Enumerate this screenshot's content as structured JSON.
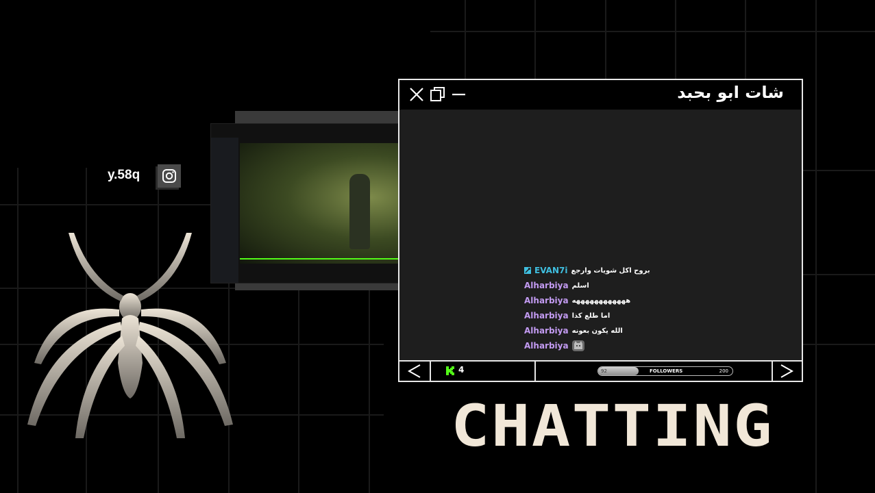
{
  "instagram": {
    "handle": "y.58q",
    "icon": "instagram-icon"
  },
  "chat": {
    "title": "شات ابو بحبد",
    "messages": [
      {
        "user": "EVAN7i",
        "user_color": "#3fbfe0",
        "badge": "sword-badge-icon",
        "text": "بروح اكل شويات وارجع"
      },
      {
        "user": "Alharbiya",
        "user_color": "#c39bf2",
        "text": "اسلم"
      },
      {
        "user": "Alharbiya",
        "user_color": "#c39bf2",
        "text": "ههههههههههههه"
      },
      {
        "user": "Alharbiya",
        "user_color": "#c39bf2",
        "text": "اما طلع كذا"
      },
      {
        "user": "Alharbiya",
        "user_color": "#c39bf2",
        "text": "الله يكون بعونه"
      },
      {
        "user": "Alharbiya",
        "user_color": "#c39bf2",
        "text": "",
        "emote": "cat-emote-icon"
      }
    ],
    "footer": {
      "kick_count": "4",
      "followers_label": "FOLLOWERS",
      "followers_current": "92",
      "followers_goal": "200",
      "followers_progress": 0.3
    }
  },
  "overlay_text": "CHATTING",
  "colors": {
    "accent_green": "#53fc18",
    "frame": "#e8e8e8",
    "title_cream": "#f1e7d8"
  }
}
